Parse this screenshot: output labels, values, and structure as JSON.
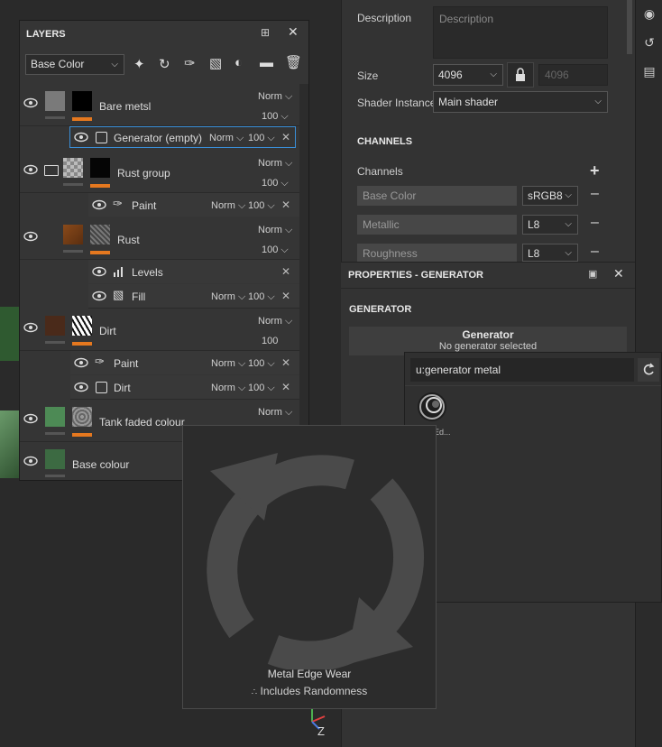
{
  "layers_panel": {
    "title": "LAYERS",
    "channel_select": "Base Color",
    "layers": [
      {
        "name": "Bare metsl",
        "blend": "Norm",
        "opacity": "100"
      },
      {
        "name": "Generator (empty)",
        "blend": "Norm",
        "opacity": "100"
      },
      {
        "name": "Rust group",
        "blend": "Norm",
        "opacity": "100"
      },
      {
        "name": "Paint",
        "blend": "Norm",
        "opacity": "100"
      },
      {
        "name": "Rust",
        "blend": "Norm",
        "opacity": "100"
      },
      {
        "name": "Levels"
      },
      {
        "name": "Fill",
        "blend": "Norm",
        "opacity": "100"
      },
      {
        "name": "Dirt",
        "blend": "Norm",
        "opacity": "100"
      },
      {
        "name": "Paint",
        "blend": "Norm",
        "opacity": "100"
      },
      {
        "name": "Dirt",
        "blend": "Norm",
        "opacity": "100"
      },
      {
        "name": "Tank faded colour",
        "blend": "Norm"
      },
      {
        "name": "Base colour"
      }
    ]
  },
  "texture_set": {
    "description_label": "Description",
    "description_placeholder": "Description",
    "size_label": "Size",
    "size_value": "4096",
    "size_value_locked": "4096",
    "shader_label": "Shader Instance",
    "shader_value": "Main shader",
    "channels_heading": "CHANNELS",
    "channels_label": "Channels",
    "channels": [
      {
        "name": "Base Color",
        "format": "sRGB8"
      },
      {
        "name": "Metallic",
        "format": "L8"
      },
      {
        "name": "Roughness",
        "format": "L8"
      }
    ]
  },
  "properties": {
    "title": "PROPERTIES - GENERATOR",
    "section": "GENERATOR",
    "generator_title": "Generator",
    "generator_status": "No generator selected"
  },
  "search_popup": {
    "query": "u:generator metal",
    "result_label": "Ed..."
  },
  "tooltip": {
    "name": "Metal Edge Wear",
    "tag": "Includes Randomness"
  },
  "gizmo": {
    "axis_z": "Z"
  },
  "colors": {
    "accent_orange": "#e5781f",
    "panel": "#353535",
    "selected_border": "#3a8fd8"
  }
}
